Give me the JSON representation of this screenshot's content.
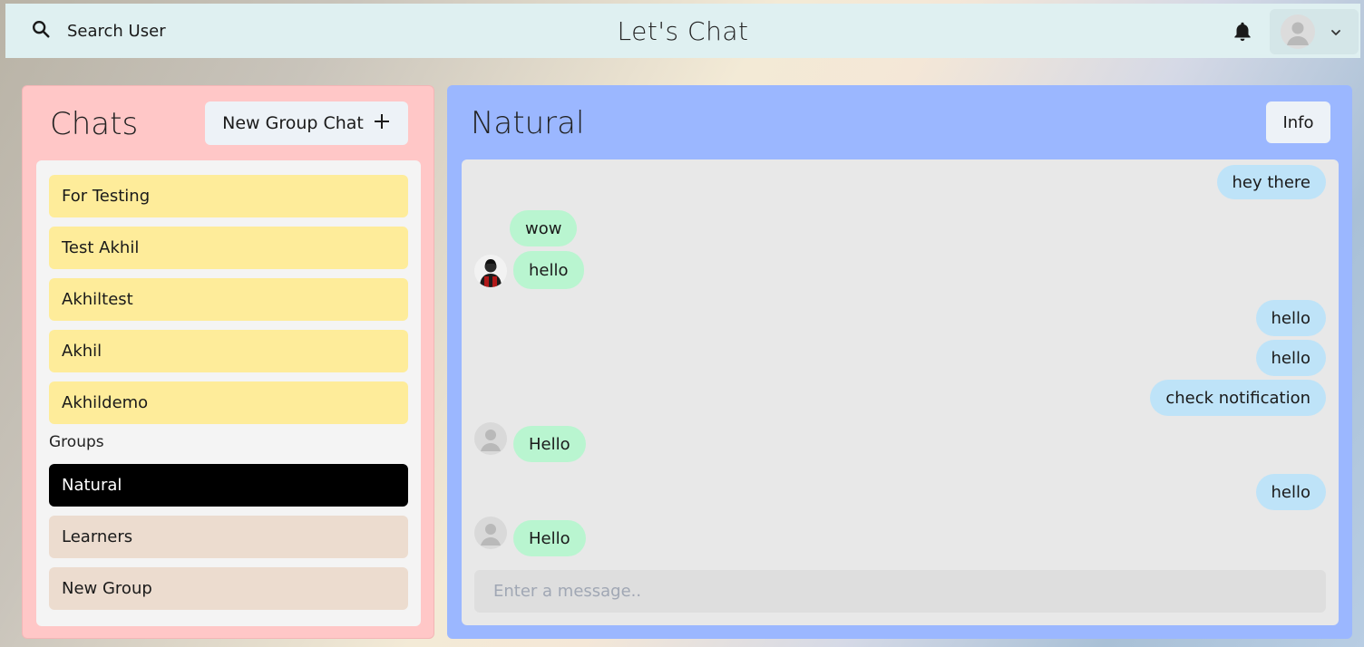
{
  "header": {
    "search_label": "Search User",
    "app_title": "Let's Chat"
  },
  "sidebar": {
    "title": "Chats",
    "new_group_label": "New Group Chat",
    "personal_chats": [
      "For Testing",
      "Test Akhil",
      "Akhiltest",
      "Akhil",
      "Akhildemo"
    ],
    "groups_label": "Groups",
    "group_chats": [
      "Natural",
      "Learners",
      "New Group"
    ],
    "active_chat": "Natural"
  },
  "conversation": {
    "title": "Natural",
    "info_label": "Info",
    "messages": [
      {
        "text": "hey there",
        "from": "me"
      },
      {
        "text": "wow",
        "from": "other"
      },
      {
        "text": "hello",
        "from": "other"
      },
      {
        "text": "hello",
        "from": "me"
      },
      {
        "text": "hello",
        "from": "me"
      },
      {
        "text": "check notification",
        "from": "me"
      },
      {
        "text": "Hello",
        "from": "other"
      },
      {
        "text": "hello",
        "from": "me"
      },
      {
        "text": "Hello",
        "from": "other"
      }
    ],
    "input_placeholder": "Enter a message.."
  },
  "colors": {
    "topbar": "#dff0f1",
    "chats_panel": "#ffc7c7",
    "conversation_panel": "#9bb7ff",
    "personal_chat": "#feec9a",
    "group_chat": "#ecdccf",
    "active_chat": "#000000",
    "my_message": "#bee3f8",
    "other_message": "#b9f5d0"
  }
}
